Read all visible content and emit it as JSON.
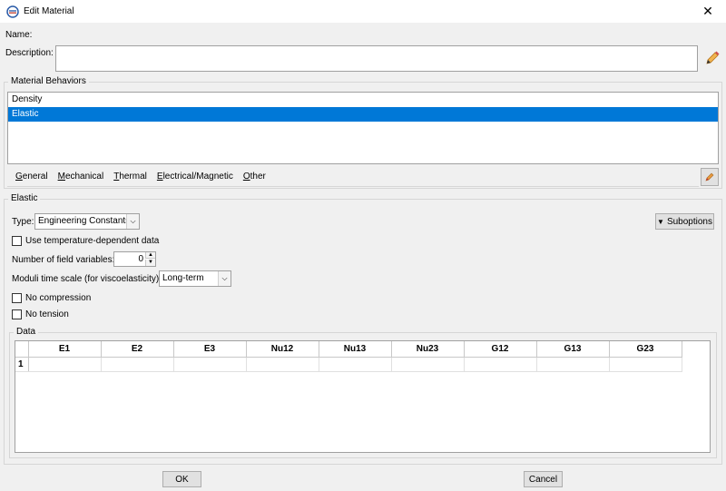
{
  "window": {
    "title": "Edit Material",
    "close_glyph": "✕"
  },
  "form": {
    "name_label": "Name:",
    "description_label": "Description:",
    "description_value": ""
  },
  "behaviors": {
    "legend": "Material Behaviors",
    "items": [
      "Density",
      "Elastic"
    ],
    "selected": "Elastic",
    "menu": [
      "General",
      "Mechanical",
      "Thermal",
      "Electrical/Magnetic",
      "Other"
    ]
  },
  "elastic": {
    "legend": "Elastic",
    "type_label": "Type:",
    "type_value": "Engineering Constants",
    "suboptions_label": "Suboptions",
    "temp_dependent_label": "Use temperature-dependent data",
    "field_vars_label": "Number of field variables:",
    "field_vars_value": "0",
    "moduli_label": "Moduli time scale (for viscoelasticity):",
    "moduli_value": "Long-term",
    "no_compression_label": "No compression",
    "no_tension_label": "No tension"
  },
  "data": {
    "legend": "Data",
    "columns": [
      "E1",
      "E2",
      "E3",
      "Nu12",
      "Nu13",
      "Nu23",
      "G12",
      "G13",
      "G23"
    ],
    "rows": [
      "1"
    ]
  },
  "footer": {
    "ok_label": "OK",
    "cancel_label": "Cancel"
  },
  "icons": {
    "app": "abaqus-app-icon",
    "edit": "pencil-icon",
    "tool": "brush-icon",
    "dropdown": "chevron-down-icon",
    "suboptions": "triangle-down-icon"
  },
  "colors": {
    "selection": "#0078d7",
    "pencil": "#e8a33d"
  }
}
